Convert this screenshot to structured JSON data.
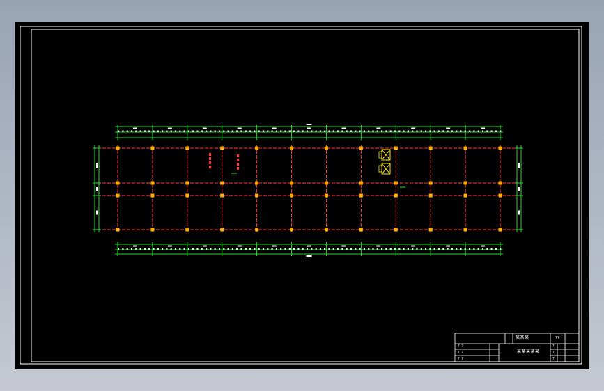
{
  "drawing": {
    "background": "#000000",
    "frame_color": "#ffffff",
    "grid_line_color": "#ff3333",
    "column_color": "#ffb000",
    "dimension_color": "#22dd22",
    "element_color": "#ffee00",
    "column_axes_count": 12,
    "row_axes_count": 4,
    "sections": [
      {
        "id": "section-mark-1",
        "text": "⊥⊥⊥⊥"
      },
      {
        "id": "section-mark-2",
        "text": "⊥⊥⊥⊥"
      }
    ]
  },
  "title_block": {
    "project_name": "某某某",
    "drawing_name": "某某某某某",
    "drawing_number": "??",
    "rows_left": [
      "? ?",
      "? ?",
      "? ?"
    ],
    "rows_right": [
      "?",
      "?",
      "?"
    ]
  }
}
